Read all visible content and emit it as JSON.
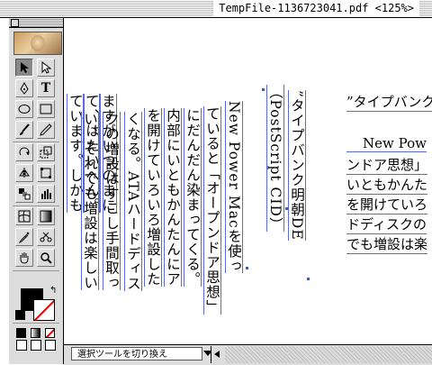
{
  "window": {
    "title": "TempFile-1136723041.pdf <125%>"
  },
  "status": {
    "tool_hint": "選択ツールを切り換え"
  },
  "colors": {
    "accent": "#5b6bd6",
    "none_slash": "#dd0000"
  },
  "document": {
    "vertical_columns": [
      "ています。しかも",
      "て、はたいへん。",
      "ますがいつのまに",
      "い、それでも増設は楽しい",
      "クの増設はすこし手間取っ",
      "くなる。ATAハードディス",
      "を開けていろいろ増設した",
      "内部にいともかんたんにア",
      "にだんだん染まってくる。",
      "ていると「オープンドア思想」",
      "New Power Macを使っ",
      "（PostScript CID）",
      "”タイプバンク明朝DE"
    ],
    "horizontal_lines": [
      "”タイプバンク",
      "New Pow",
      "ンドア思想」",
      "いともかんた",
      "を開けていろ",
      "ドディスクの",
      "でも増設は楽"
    ]
  }
}
